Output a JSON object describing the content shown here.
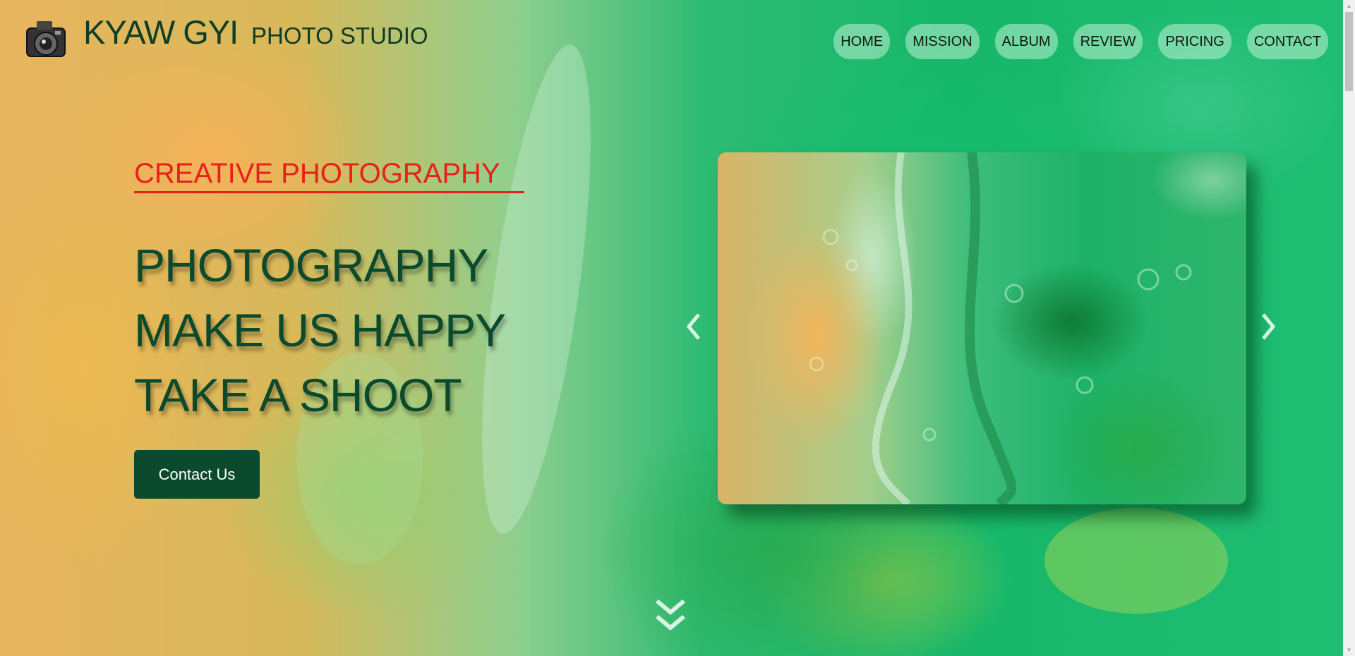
{
  "header": {
    "brand_main": "KYAW GYI",
    "brand_sub": "PHOTO STUDIO",
    "logo_icon": "camera-icon"
  },
  "nav": {
    "items": [
      {
        "label": "HOME"
      },
      {
        "label": "MISSION"
      },
      {
        "label": "ALBUM"
      },
      {
        "label": "REVIEW"
      },
      {
        "label": "PRICING"
      },
      {
        "label": "CONTACT"
      }
    ]
  },
  "hero": {
    "kicker": "CREATIVE PHOTOGRAPHY",
    "lines": [
      "PHOTOGRAPHY",
      "MAKE US HAPPY",
      "TAKE A SHOOT"
    ],
    "cta_label": "Contact Us"
  },
  "carousel": {
    "prev_icon": "chevron-left-icon",
    "next_icon": "chevron-right-icon"
  },
  "scroll_hint_icon": "double-chevron-down-icon",
  "colors": {
    "accent_red": "#e8201a",
    "dark_green": "#0b4a2c",
    "nav_pill": "#bef0d2"
  }
}
